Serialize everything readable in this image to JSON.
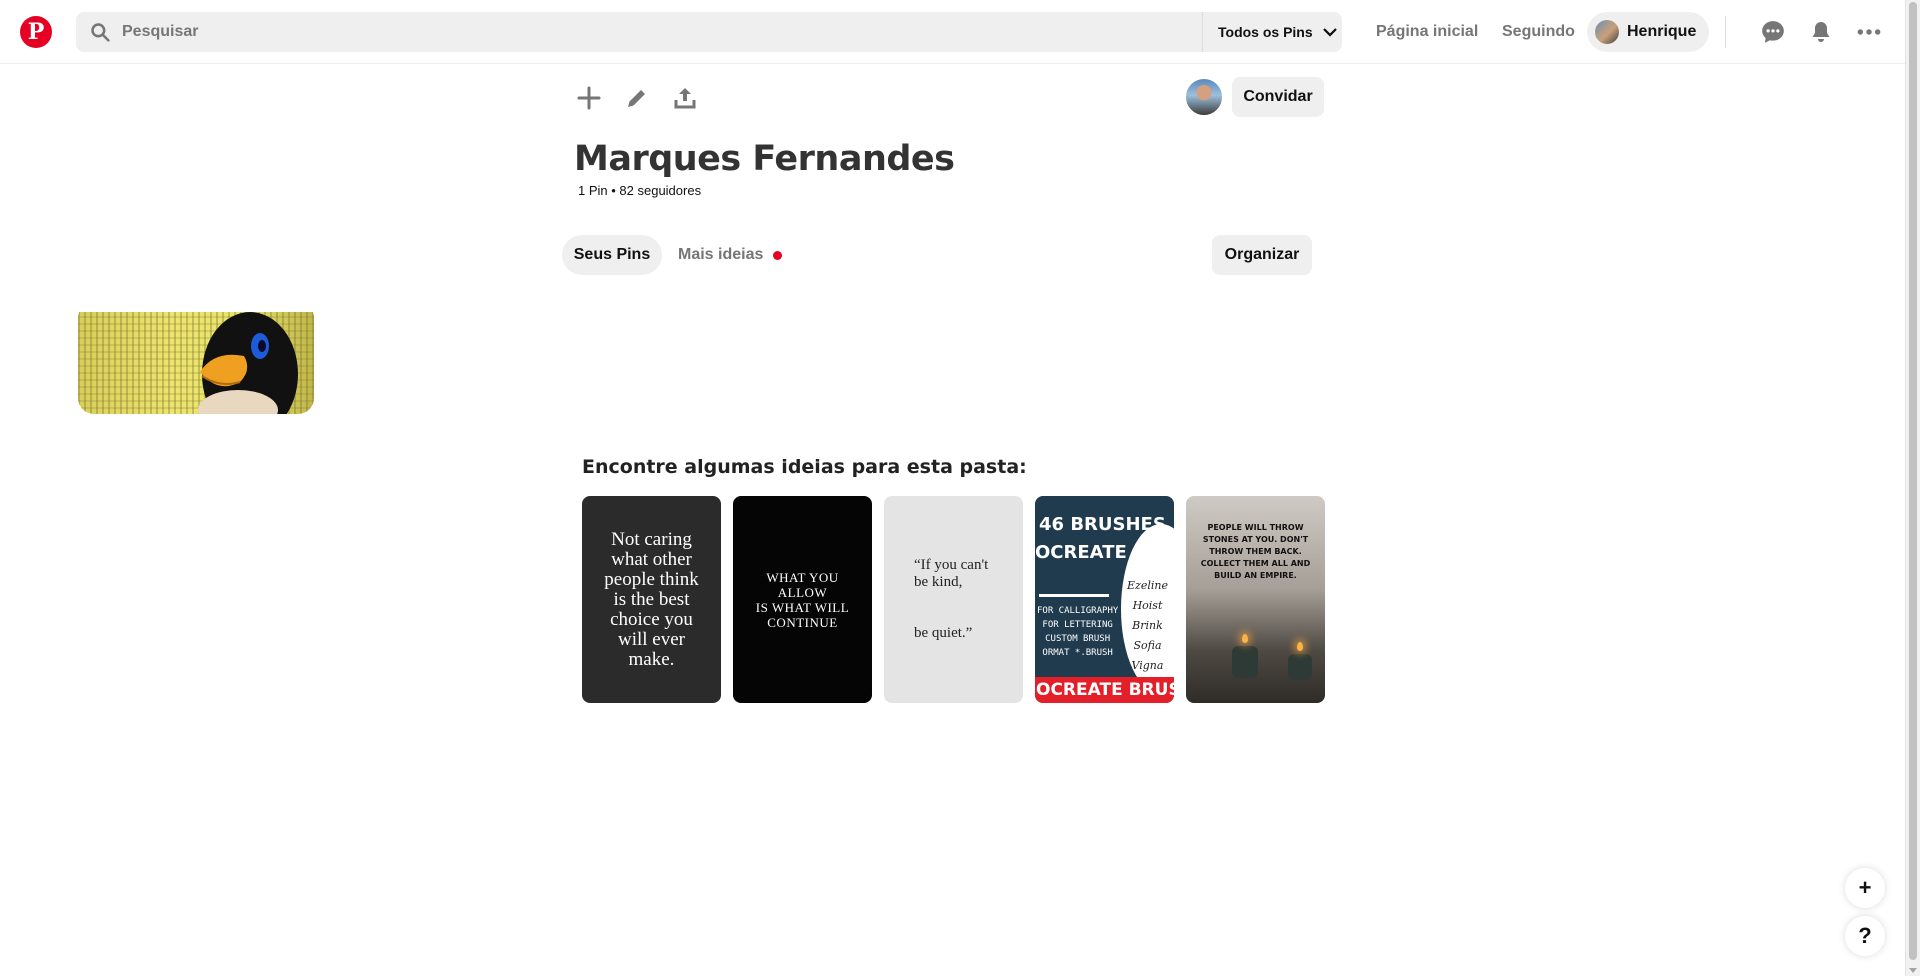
{
  "header": {
    "search_placeholder": "Pesquisar",
    "scope_label": "Todos os Pins",
    "nav_home": "Página inicial",
    "nav_following": "Seguindo",
    "user_name": "Henrique"
  },
  "board": {
    "invite_label": "Convidar",
    "title": "Marques Fernandes",
    "meta": "1 Pin • 82 seguidores",
    "tabs": [
      "Seus Pins",
      "Mais ideias"
    ],
    "organize_label": "Organizar"
  },
  "ideas": {
    "title": "Encontre algumas ideias para esta pasta:",
    "cards": [
      {
        "text": "Not caring\nwhat other\npeople think\nis the best\nchoice you\nwill ever\nmake."
      },
      {
        "text": "WHAT YOU\nALLOW\nIS WHAT WILL\nCONTINUE"
      },
      {
        "text": "“If you can't\nbe kind,\n\n\nbe quiet.”"
      },
      {
        "heading1": "46 BRUSHES",
        "heading2": "OCREATE",
        "subtitle": "FOR CALLIGRAPHY\nFOR LETTERING\nCUSTOM BRUSH\nORMAT *.BRUSH",
        "script": "Ezeline\nHoist\nBrink\nSofia\nVigna",
        "footer": "OCREATE BRUSH"
      },
      {
        "text": "PEOPLE WILL THROW STONES AT YOU. DON'T THROW THEM BACK. COLLECT THEM ALL AND BUILD AN EMPIRE."
      }
    ]
  },
  "floating": {
    "add": "+",
    "help": "?"
  },
  "colors": {
    "brand": "#e60023",
    "pill_bg": "#efefef",
    "muted_text": "#767676"
  }
}
